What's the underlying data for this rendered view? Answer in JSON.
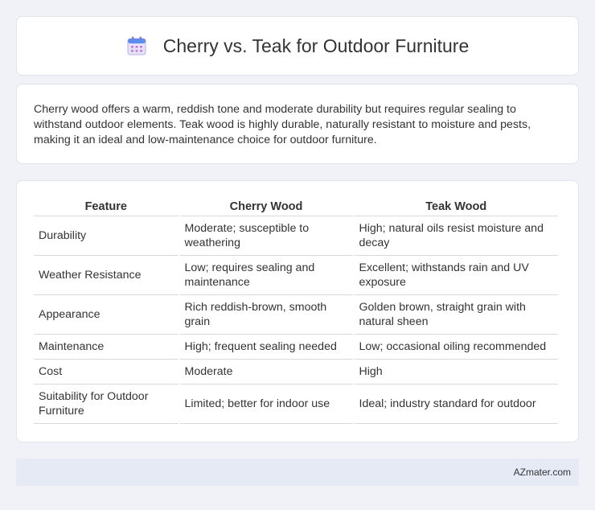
{
  "header": {
    "title": "Cherry vs. Teak for Outdoor Furniture",
    "icon": "calendar-icon"
  },
  "intro": {
    "text": "Cherry wood offers a warm, reddish tone and moderate durability but requires regular sealing to withstand outdoor elements. Teak wood is highly durable, naturally resistant to moisture and pests, making it an ideal and low-maintenance choice for outdoor furniture."
  },
  "table": {
    "headers": [
      "Feature",
      "Cherry Wood",
      "Teak Wood"
    ],
    "rows": [
      [
        "Durability",
        "Moderate; susceptible to weathering",
        "High; natural oils resist moisture and decay"
      ],
      [
        "Weather Resistance",
        "Low; requires sealing and maintenance",
        "Excellent; withstands rain and UV exposure"
      ],
      [
        "Appearance",
        "Rich reddish-brown, smooth grain",
        "Golden brown, straight grain with natural sheen"
      ],
      [
        "Maintenance",
        "High; frequent sealing needed",
        "Low; occasional oiling recommended"
      ],
      [
        "Cost",
        "Moderate",
        "High"
      ],
      [
        "Suitability for Outdoor Furniture",
        "Limited; better for indoor use",
        "Ideal; industry standard for outdoor"
      ]
    ]
  },
  "footer": {
    "brand": "AZmater.com"
  }
}
